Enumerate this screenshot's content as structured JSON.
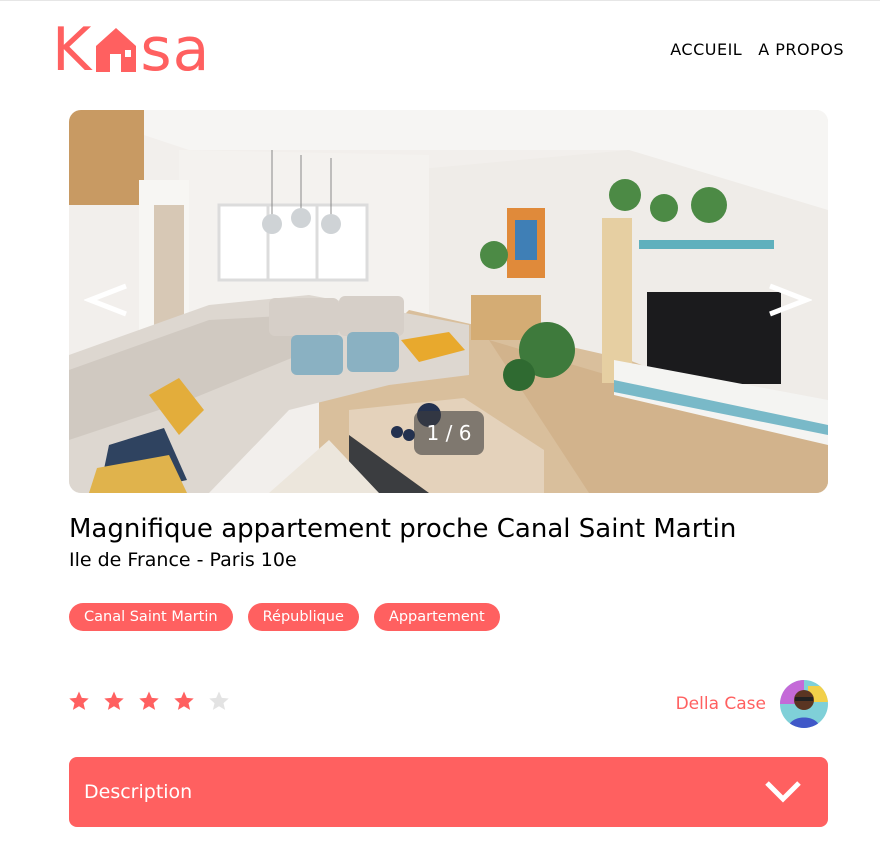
{
  "brand": {
    "logo_text_before": "K",
    "logo_text_after": "sa",
    "logo_icon": "house-icon",
    "accent_color": "#ff6060"
  },
  "nav": {
    "items": [
      {
        "label": "ACCUEIL"
      },
      {
        "label": "A PROPOS"
      }
    ]
  },
  "gallery": {
    "counter": "1 / 6",
    "prev_icon": "chevron-left-icon",
    "next_icon": "chevron-right-icon"
  },
  "listing": {
    "title": "Magnifique appartement proche Canal Saint Martin",
    "location": "Ile de France - Paris 10e",
    "tags": [
      "Canal Saint Martin",
      "République",
      "Appartement"
    ],
    "rating": 4,
    "rating_max": 5,
    "star_active_color": "#ff6060",
    "star_inactive_color": "#e3e3e3"
  },
  "host": {
    "name": "Della Case"
  },
  "collapse": {
    "title": "Description",
    "icon": "chevron-down-icon"
  }
}
